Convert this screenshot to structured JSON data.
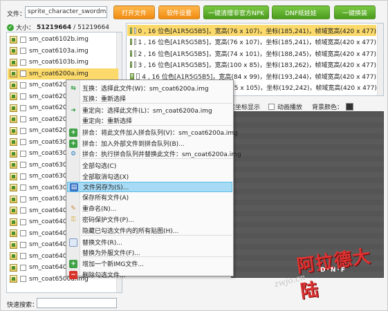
{
  "topbar": {
    "file_label": "文件：",
    "file_value": "sprite_character_swordms",
    "btn_open": "打开文件",
    "btn_settings": "软件设置",
    "btn_clean": "一键清理非官方NPK",
    "btn_dnf": "DNF纸娃娃",
    "btn_swap": "一键换装",
    "size_label": "大小：",
    "size_value": "51219664",
    "size_sep": " / ",
    "size_total": "51219664"
  },
  "file_list": [
    "sm_coat6102b.img",
    "sm_coat6103a.img",
    "sm_coat6103b.img",
    "sm_coat6200a.img",
    "sm_coat620",
    "sm_coat620",
    "sm_coat620",
    "sm_coat620",
    "sm_coat620",
    "sm_coat630",
    "sm_coat630",
    "sm_coat630",
    "sm_coat630",
    "sm_coat630",
    "sm_coat630",
    "sm_coat640",
    "sm_coat640",
    "sm_coat640",
    "sm_coat640",
    "sm_coat640",
    "sm_coat640",
    "sm_coat6500a.img"
  ],
  "selected_file_index": 3,
  "quick_search_label": "快速搜索：",
  "frames": [
    "0 , 16 位色[A1R5G5B5]，宽高(76 x 107)，坐标(185,241)，帧域宽高(420 x 477)",
    "1 , 16 位色[A1R5G5B5]，宽高(76 x 107)，坐标(185,241)，帧域宽高(420 x 477)",
    "2 , 16 位色[A1R5G5B5]，宽高(74 x 101)，坐标(188,245)，帧域宽高(420 x 477)",
    "3 , 16 位色[A1R5G5B5]，宽高(100 x 85)，坐标(183,262)，帧域宽高(420 x 477)",
    "4 , 16 位色[A1R5G5B5]，宽高(84 x 99)，坐标(193,244)，帧域宽高(420 x 477)",
    "85 x 105)，坐标(192,242)，帧域宽高(420 x 477)",
    "85 x 105)，坐标(192,243)，帧域宽高(420 x 477)"
  ],
  "options": {
    "show_coords": "实坐标显示",
    "animate": "动画播放",
    "bg_color": "背景颜色："
  },
  "context_menu": [
    {
      "label": "互换：选择此文件(W)：sm_coat6200a.img",
      "icon": "swap-icon"
    },
    {
      "label": "互换：重新选择",
      "icon": ""
    },
    {
      "label": "重定向：选择此文件(L)：sm_coat6200a.img",
      "icon": "redirect-icon"
    },
    {
      "label": "重定向：重新选择",
      "icon": ""
    },
    {
      "label": "拼合：将此文件加入拼合队列(V)：sm_coat6200a.img",
      "icon": "plus-icon"
    },
    {
      "label": "拼合：加入外部文件到拼合队列(B)...",
      "icon": "plus-icon"
    },
    {
      "label": "拼合：执行拼合队列并替换此文件：sm_coat6200a.img",
      "icon": "gear-icon"
    },
    {
      "label": "全部勾选(C)",
      "icon": ""
    },
    {
      "label": "全部取消勾选(X)",
      "icon": ""
    },
    {
      "label": "文件另存为(S)...",
      "icon": "save-icon"
    },
    {
      "label": "保存所有文件(A)",
      "icon": ""
    },
    {
      "label": "重命名(N)...",
      "icon": "rename-icon"
    },
    {
      "label": "密码保护文件(P)...",
      "icon": "key-icon"
    },
    {
      "label": "隐藏已勾选文件内的所有贴图(H)...",
      "icon": ""
    },
    {
      "label": "替换文件(R)...",
      "icon": "replace-icon"
    },
    {
      "label": "替换为外服文件(F)...",
      "icon": ""
    },
    {
      "label": "增加一个新IMG文件...",
      "icon": "plus-icon"
    },
    {
      "label": "删除勾选文件...",
      "icon": "delete-icon"
    }
  ],
  "highlighted_menu_index": 9,
  "watermark": {
    "brand": "阿拉德大陆",
    "sub": "D·N·F",
    "url": "zwjo.cn"
  }
}
